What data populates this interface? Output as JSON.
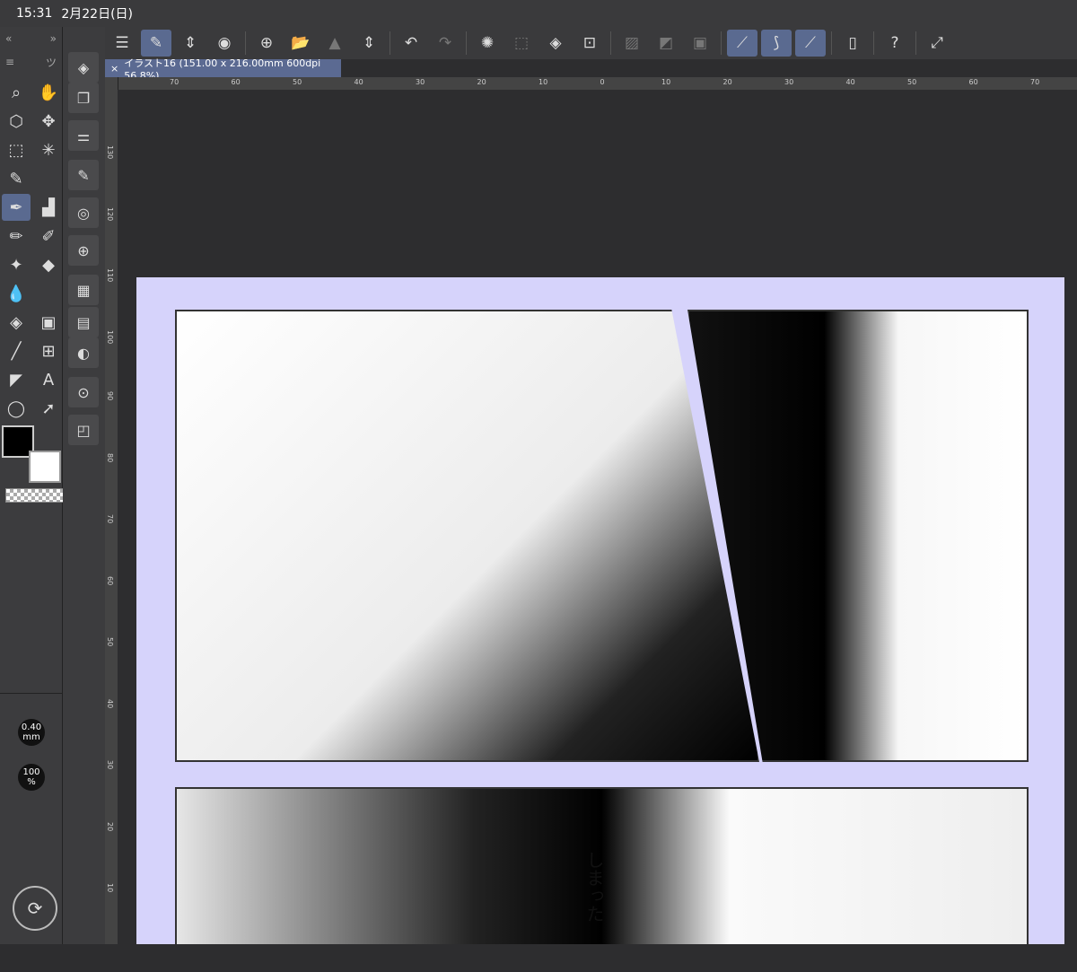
{
  "status": {
    "time": "15:31",
    "date": "2月22日(日)"
  },
  "left_panel": {
    "collapse_left": "«",
    "collapse_right": "»"
  },
  "tool_tab_label": "ツ",
  "tools": [
    {
      "name": "zoom-icon",
      "glyph": "⌕"
    },
    {
      "name": "hand-icon",
      "glyph": "✋"
    },
    {
      "name": "object-select-icon",
      "glyph": "⬡"
    },
    {
      "name": "move-icon",
      "glyph": "✥"
    },
    {
      "name": "marquee-icon",
      "glyph": "⬚"
    },
    {
      "name": "magic-wand-icon",
      "glyph": "✳"
    },
    {
      "name": "eyedropper-icon",
      "glyph": "✎"
    },
    {
      "name": "blank",
      "glyph": ""
    },
    {
      "name": "pen-icon",
      "glyph": "✒",
      "active": true
    },
    {
      "name": "airbrush-icon",
      "glyph": "▟"
    },
    {
      "name": "pencil-icon",
      "glyph": "✏"
    },
    {
      "name": "brush-icon",
      "glyph": "✐"
    },
    {
      "name": "decoration-icon",
      "glyph": "✦"
    },
    {
      "name": "eraser-icon",
      "glyph": "◆"
    },
    {
      "name": "blend-icon",
      "glyph": "💧"
    },
    {
      "name": "blank2",
      "glyph": ""
    },
    {
      "name": "fill-icon",
      "glyph": "◈"
    },
    {
      "name": "gradient-icon",
      "glyph": "▣"
    },
    {
      "name": "line-icon",
      "glyph": "╱"
    },
    {
      "name": "frame-icon",
      "glyph": "⊞"
    },
    {
      "name": "ruler-icon",
      "glyph": "◤"
    },
    {
      "name": "text-icon",
      "glyph": "A"
    },
    {
      "name": "lasso-icon",
      "glyph": "◯"
    },
    {
      "name": "operation-icon",
      "glyph": "➚"
    }
  ],
  "brush": {
    "size": "0.40\nmm",
    "opacity": "100\n%"
  },
  "doc_tab": {
    "close": "×",
    "title": "イラスト16 (151.00 x 216.00mm 600dpi 56.8%)"
  },
  "ruler_top": [
    "70",
    "60",
    "50",
    "40",
    "30",
    "20",
    "10",
    "0",
    "10",
    "20",
    "30",
    "40",
    "50",
    "60",
    "70"
  ],
  "ruler_left": [
    "130",
    "120",
    "110",
    "100",
    "90",
    "80",
    "70",
    "60",
    "50",
    "40",
    "30",
    "20",
    "10"
  ],
  "speech_text": "しまった"
}
